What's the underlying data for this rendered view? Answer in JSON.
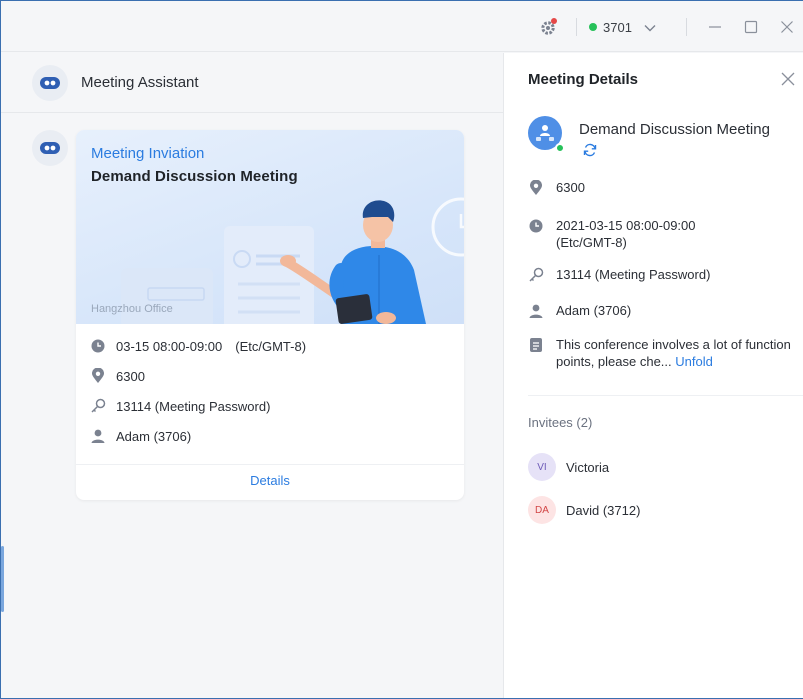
{
  "titlebar": {
    "status_number": "3701",
    "status_color": "#27c15a"
  },
  "chat": {
    "title": "Meeting Assistant"
  },
  "card": {
    "kicker": "Meeting Inviation",
    "title": "Demand Discussion Meeting",
    "office": "Hangzhou Office",
    "time": "03-15 08:00-09:00 (Etc/GMT-8)",
    "room": "6300",
    "password": "13114 (Meeting Password)",
    "host": "Adam (3706)",
    "details_label": "Details"
  },
  "details": {
    "title": "Meeting Details",
    "meeting_name": "Demand Discussion Meeting",
    "room": "6300",
    "time": "2021-03-15 08:00-09:00 (Etc/GMT-8)",
    "password": "13114 (Meeting Password)",
    "host": "Adam (3706)",
    "description": "This conference involves a lot of function points, please che...",
    "unfold_label": "Unfold",
    "invitees_label": "Invitees (2)",
    "invitees": [
      {
        "initials": "VI",
        "name": "Victoria",
        "bg": "#e6e2f7",
        "fg": "#6e5bb8"
      },
      {
        "initials": "DA",
        "name": "David (3712)",
        "bg": "#fde4e4",
        "fg": "#d24545"
      }
    ]
  },
  "colors": {
    "accent": "#2b7ce0",
    "online": "#27c15a"
  }
}
